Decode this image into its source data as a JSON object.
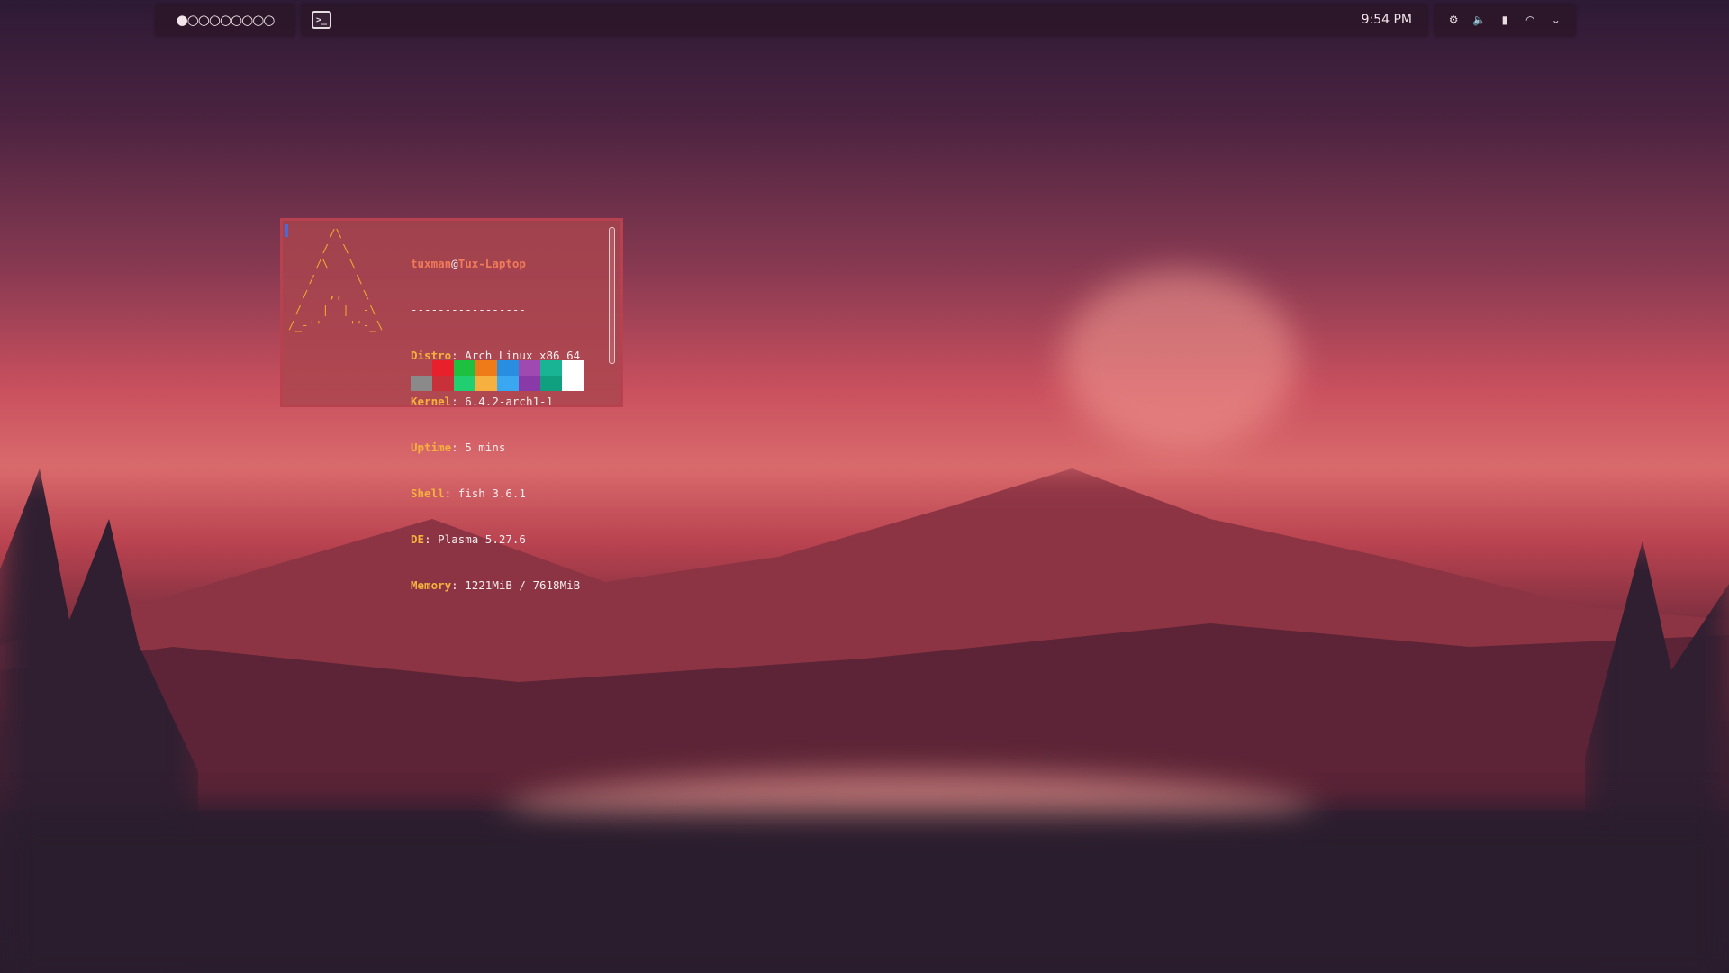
{
  "panel": {
    "pager_dots": "●○○○○○○○○",
    "task_terminal_glyph": ">_",
    "clock": "9:54 PM",
    "tray": {
      "icons": [
        "network-settings-icon",
        "volume-icon",
        "battery-icon",
        "wifi-icon",
        "chevron-down-icon"
      ],
      "glyphs": [
        "⚙",
        "🔈",
        "▮",
        "◠",
        "⌄"
      ]
    }
  },
  "terminal": {
    "ascii_art": "      /\\\n     /  \\\n    /\\   \\\n   /      \\\n  /   ,,   \\\n /   |  |  -\\\n/_-''    ''-_\\",
    "user": "tuxman",
    "at": "@",
    "host": "Tux-Laptop",
    "separator": "-----------------",
    "fields": [
      {
        "key": "Distro",
        "value": "Arch Linux x86_64"
      },
      {
        "key": "Kernel",
        "value": "6.4.2-arch1-1"
      },
      {
        "key": "Uptime",
        "value": "5 mins"
      },
      {
        "key": "Shell",
        "value": "fish 3.6.1"
      },
      {
        "key": "DE",
        "value": "Plasma 5.27.6"
      },
      {
        "key": "Memory",
        "value": "1221MiB / 7618MiB"
      }
    ],
    "palette_top": [
      "#a54a52",
      "#e8202c",
      "#1ec040",
      "#ef7a18",
      "#2a8ee0",
      "#9e4ab0",
      "#18b494",
      "#ffffff"
    ],
    "palette_bottom": [
      "#8a8a8a",
      "#c8303a",
      "#20d070",
      "#f5b040",
      "#3aa8f0",
      "#8a3aa8",
      "#10a080",
      "#ffffff"
    ]
  }
}
